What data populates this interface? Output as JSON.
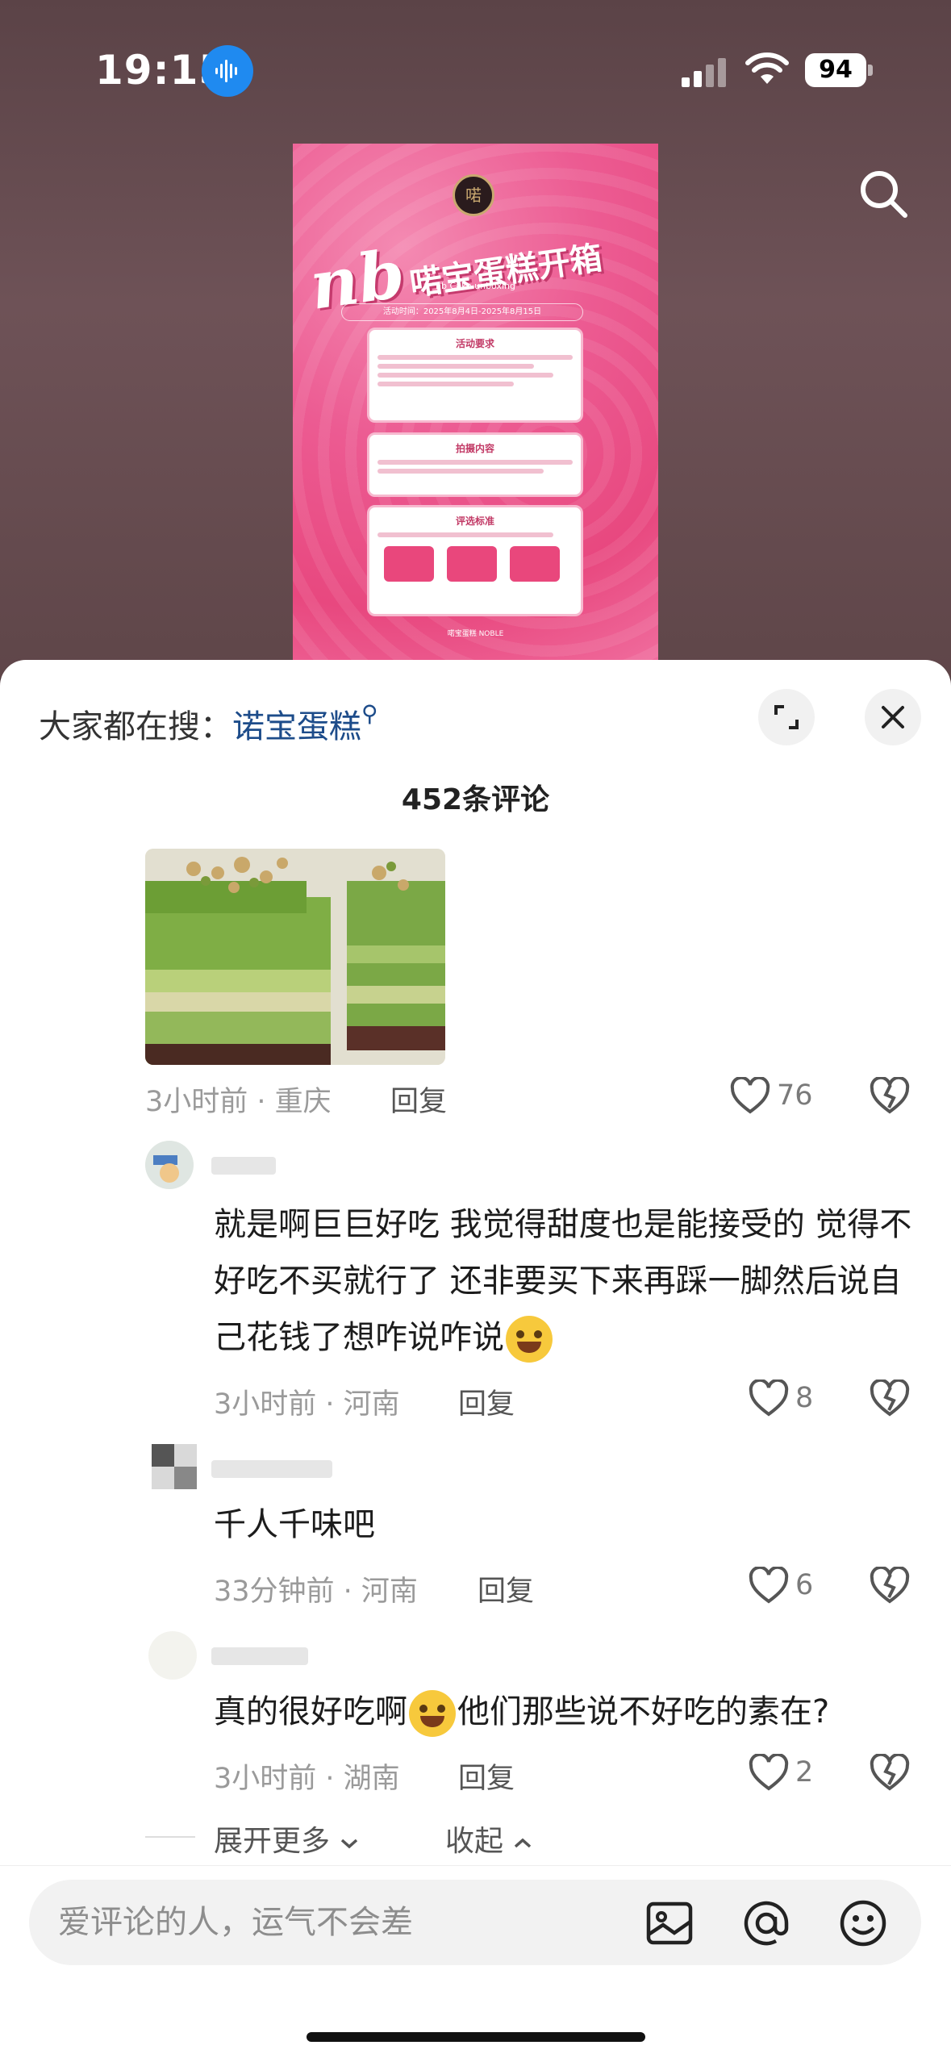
{
  "status_bar": {
    "time": "19:15",
    "battery": "94"
  },
  "poster": {
    "title_big": "nb",
    "title_small": "喏宝蛋糕开箱",
    "subtitle": "nb Cake unboxing",
    "date_line": "活动时间：2025年8月4日-2025年8月15日",
    "card1_title": "活动要求",
    "card2_title": "拍摄内容",
    "card3_title": "评选标准",
    "footer": "喏宝蛋糕 NOBLE",
    "logo_text": "喏"
  },
  "sheet": {
    "search_prefix": "大家都在搜：",
    "search_keyword": "诺宝蛋糕",
    "comment_count": "452条评论"
  },
  "comments": [
    {
      "meta": "3小时前 · 重庆",
      "reply": "回复",
      "likes": "76"
    },
    {
      "text": "就是啊巨巨好吃 我觉得甜度也是能接受的 觉得不好吃不买就行了 还非要买下来再踩一脚然后说自己花钱了想咋说咋说",
      "meta": "3小时前 · 河南",
      "reply": "回复",
      "likes": "8"
    },
    {
      "text": "千人千味吧",
      "meta": "33分钟前 · 河南",
      "reply": "回复",
      "likes": "6"
    },
    {
      "text_a": "真的很好吃啊",
      "text_b": "他们那些说不好吃的素在?",
      "meta": "3小时前 · 湖南",
      "reply": "回复",
      "likes": "2"
    }
  ],
  "expand": {
    "more": "展开更多",
    "collapse": "收起"
  },
  "input": {
    "placeholder": "爱评论的人，运气不会差"
  },
  "icons": [
    "voice-icon",
    "signal-icon",
    "wifi-icon",
    "search-icon",
    "fullscreen-icon",
    "close-icon",
    "heart-icon",
    "broken-heart-icon",
    "image-icon",
    "at-icon",
    "emoji-icon"
  ],
  "colors": {
    "accent_link": "#1d4c8a",
    "poster_pink": "#ec5b92",
    "voice_blue": "#1f8af0"
  }
}
